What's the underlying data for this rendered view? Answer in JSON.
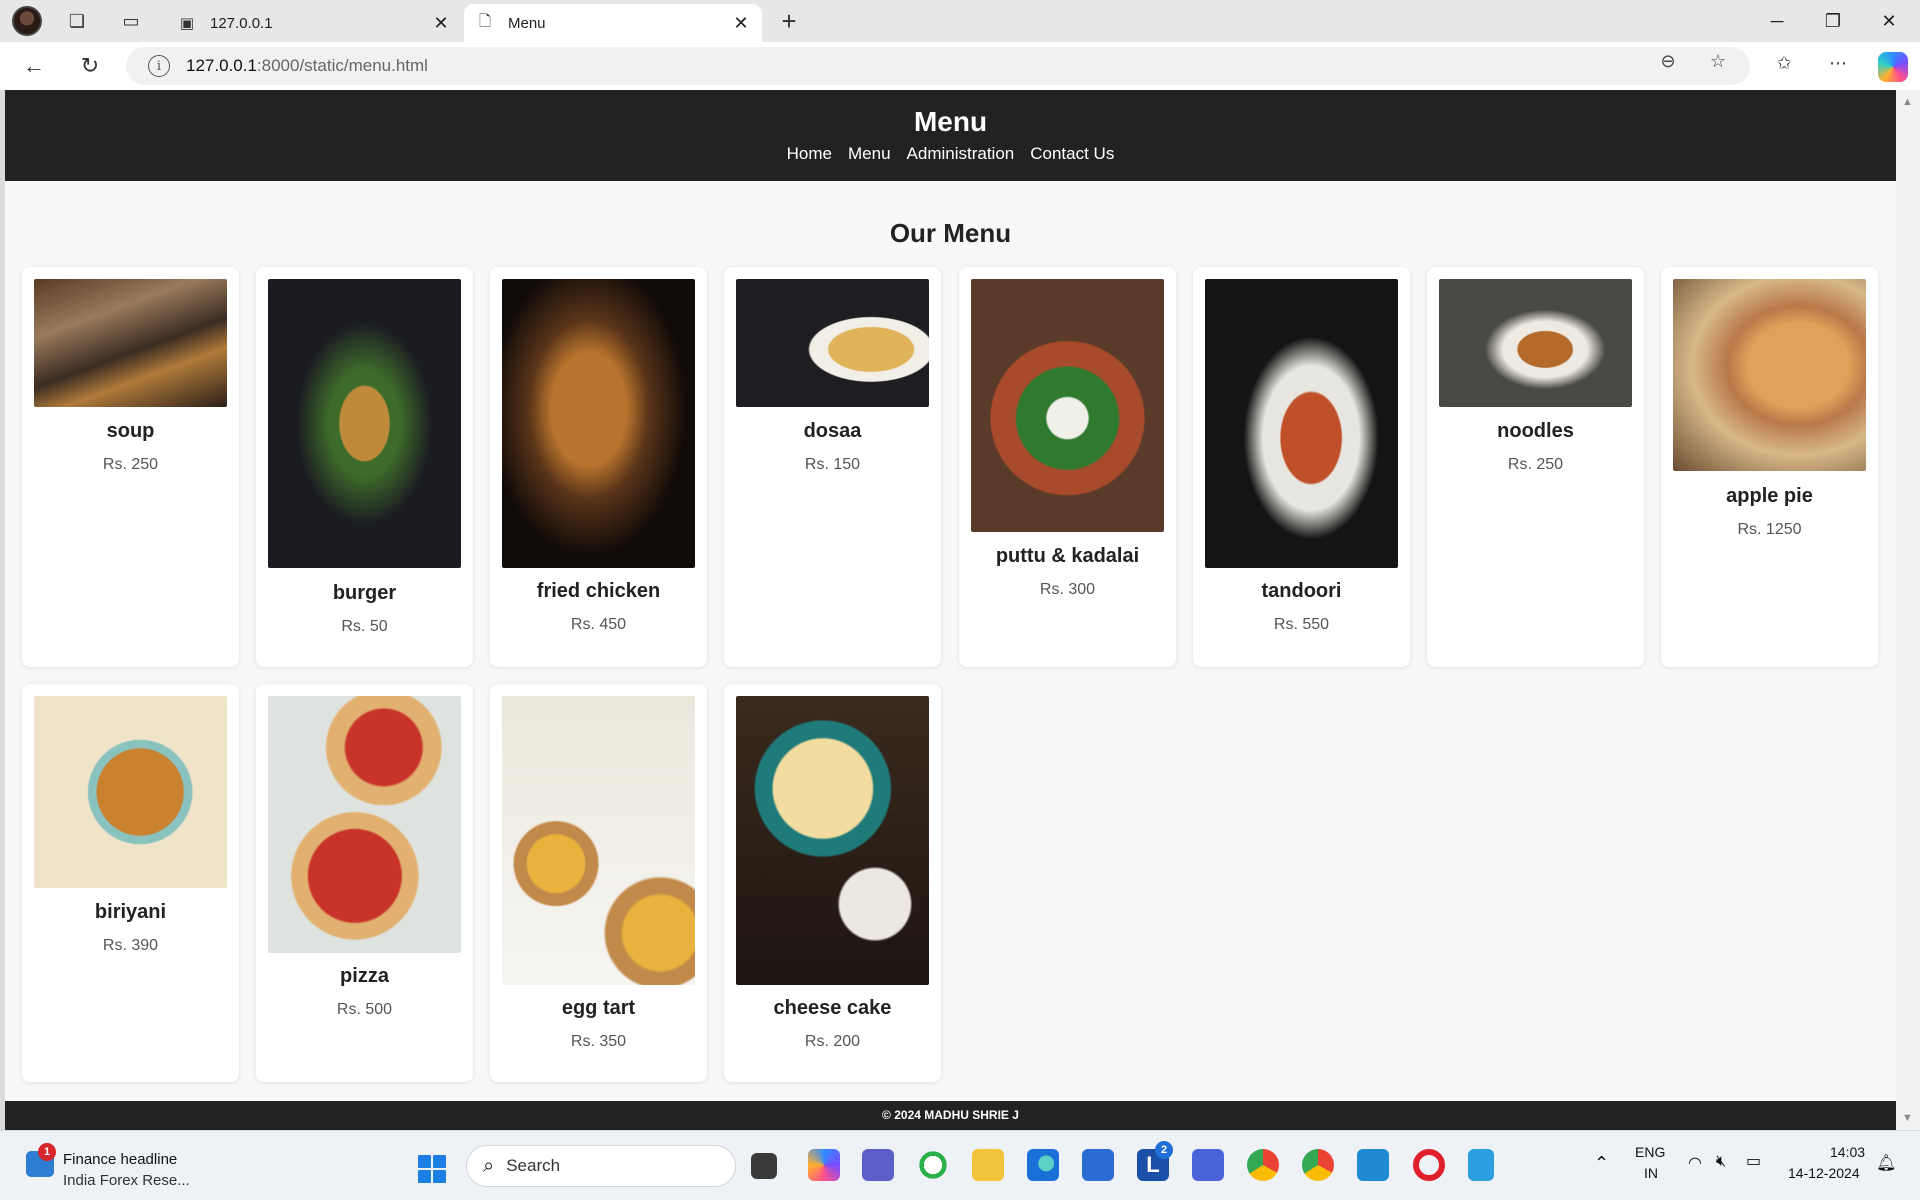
{
  "browser": {
    "tabs": [
      {
        "title": "127.0.0.1",
        "active": false
      },
      {
        "title": "Menu",
        "active": true
      }
    ],
    "url_host": "127.0.0.1",
    "url_path": ":8000/static/menu.html"
  },
  "site": {
    "title": "Menu",
    "nav": [
      "Home",
      "Menu",
      "Administration",
      "Contact Us"
    ],
    "section_title": "Our Menu",
    "footer": "© 2024 MADHU SHRIE J"
  },
  "menu_items": [
    {
      "name": "soup",
      "price": "Rs. 250"
    },
    {
      "name": "burger",
      "price": "Rs. 50"
    },
    {
      "name": "fried chicken",
      "price": "Rs. 450"
    },
    {
      "name": "dosaa",
      "price": "Rs. 150"
    },
    {
      "name": "puttu & kadalai",
      "price": "Rs. 300"
    },
    {
      "name": "tandoori",
      "price": "Rs. 550"
    },
    {
      "name": "noodles",
      "price": "Rs. 250"
    },
    {
      "name": "apple pie",
      "price": "Rs. 1250"
    },
    {
      "name": "biriyani",
      "price": "Rs. 390"
    },
    {
      "name": "pizza",
      "price": "Rs. 500"
    },
    {
      "name": "egg tart",
      "price": "Rs. 350"
    },
    {
      "name": "cheese cake",
      "price": "Rs. 200"
    }
  ],
  "taskbar": {
    "news_badge": "1",
    "news_title": "Finance headline",
    "news_subtitle": "India Forex Rese...",
    "search_label": "Search",
    "teams_badge": "2",
    "language_top": "ENG",
    "language_bottom": "IN",
    "time": "14:03",
    "date": "14-12-2024"
  }
}
